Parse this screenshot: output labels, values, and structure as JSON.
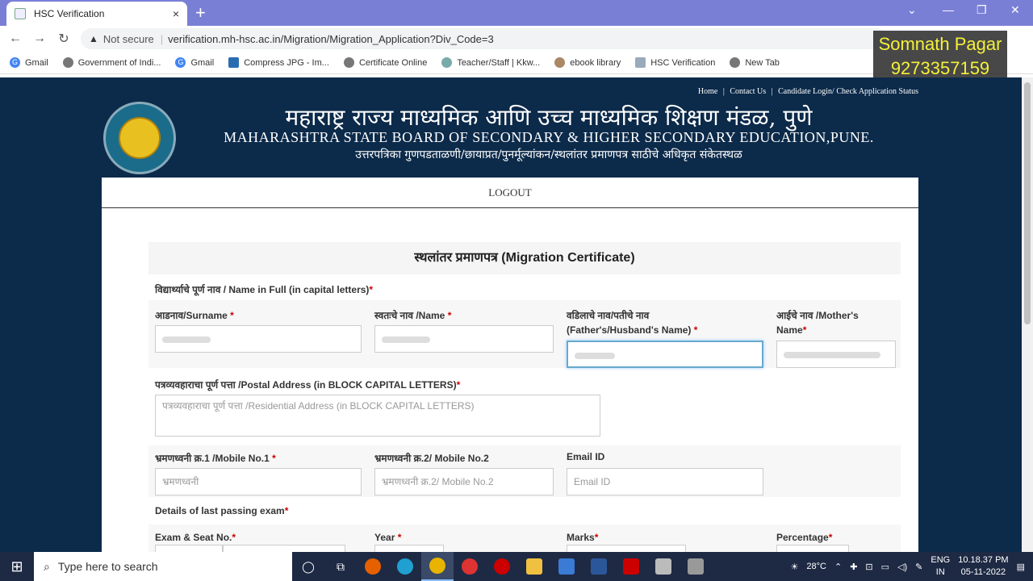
{
  "browser": {
    "tab_title": "HSC Verification",
    "tab_close": "×",
    "new_tab": "+",
    "not_secure": "Not secure",
    "url": "verification.mh-hsc.ac.in/Migration/Migration_Application?Div_Code=3",
    "bookmarks": [
      "Gmail",
      "Government of Indi...",
      "Gmail",
      "Compress JPG - Im...",
      "Certificate Online",
      "Teacher/Staff | Kkw...",
      "ebook library",
      "HSC Verification",
      "New Tab"
    ]
  },
  "overlay": {
    "name": "Somnath Pagar",
    "phone": "9273357159"
  },
  "site": {
    "toplinks": [
      "Home",
      "|",
      "Contact Us",
      "|",
      "Candidate Login/ Check Application Status"
    ],
    "title_mr": "महाराष्ट्र राज्य माध्यमिक आणि उच्च माध्यमिक शिक्षण मंडळ, पुणे",
    "title_en": "MAHARASHTRA STATE BOARD OF SECONDARY & HIGHER SECONDARY EDUCATION,PUNE.",
    "subtitle_mr": "उत्तरपत्रिका गुणपडताळणी/छायाप्रत/पुनर्मूल्यांकन/स्थलांतर प्रमाणपत्र साठीचे अधिकृत संकेतस्थळ",
    "logout": "LOGOUT"
  },
  "form": {
    "title": "स्थलांतर प्रमाणपत्र (Migration Certificate)",
    "full_name_label": "विद्यार्थ्याचे पूर्ण नाव / Name in Full (in capital letters)",
    "surname_label": "आडनाव/Surname",
    "name_label": "स्वतःचे नाव /Name",
    "father_label_1": "वडिलाचे नाव/पतीचे नाव",
    "father_label_2": "(Father's/Husband's Name)",
    "mother_label_1": "आईचे नाव /Mother's",
    "mother_label_2": "Name",
    "address_label": "पत्रव्यवहाराचा पूर्ण पत्ता /Postal Address (in BLOCK CAPITAL LETTERS)",
    "address_placeholder": "पत्रव्यवहाराचा पूर्ण पत्ता /Residential Address (in BLOCK CAPITAL LETTERS)",
    "mobile1_label": "भ्रमणध्वनी क्र.1 /Mobile No.1",
    "mobile1_placeholder": "भ्रमणध्वनी",
    "mobile2_label": "भ्रमणध्वनी क्र.2/ Mobile No.2",
    "mobile2_placeholder": "भ्रमणध्वनी क्र.2/ Mobile No.2",
    "email_label": "Email ID",
    "email_placeholder": "Email ID",
    "last_exam_label": "Details of last passing exam",
    "exam_seat_label": "Exam & Seat No.",
    "year_label": "Year",
    "marks_label": "Marks",
    "percentage_label": "Percentage",
    "required_mark": "*"
  },
  "taskbar": {
    "search_placeholder": "Type here to search",
    "weather": "28°C",
    "lang_1": "ENG",
    "lang_2": "IN",
    "time": "10.18.37 PM",
    "date": "05-11-2022"
  }
}
